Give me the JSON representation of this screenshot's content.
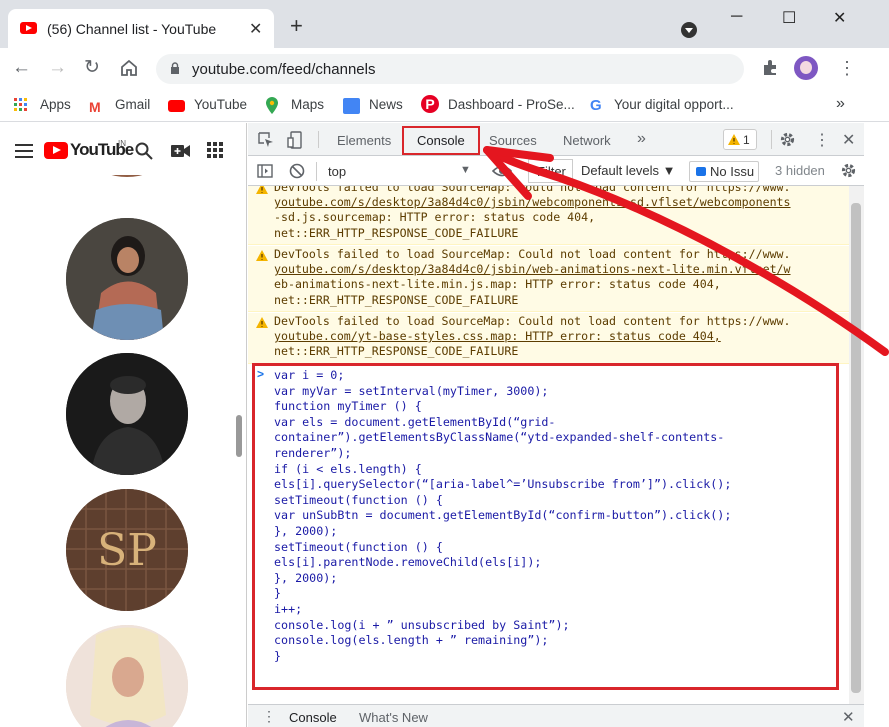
{
  "browser": {
    "tab_title": "(56) Channel list - YouTube",
    "tab_close": "✕",
    "new_tab": "+",
    "window_minimize": "─",
    "window_maximize": "☐",
    "window_close": "✕",
    "url": "youtube.com/feed/channels",
    "bookmarks": [
      "Apps",
      "Gmail",
      "YouTube",
      "Maps",
      "News",
      "Dashboard - ProSe...",
      "Your digital opport..."
    ],
    "bookmarks_more": "»"
  },
  "youtube": {
    "logo_text": "YouTube",
    "region": "IN",
    "avatar_icons": [
      "avatar-partial-icon",
      "avatar-woman-icon",
      "avatar-man-icon",
      "avatar-monogram-icon",
      "avatar-woman-blonde-icon"
    ]
  },
  "devtools": {
    "tabs": [
      "Elements",
      "Console",
      "Sources",
      "Network"
    ],
    "more_tabs": "»",
    "warning_count": "1",
    "context": "top",
    "filter_placeholder": "Filter",
    "levels": "Default levels ▼",
    "issues": "No Issu",
    "hidden": "3 hidden",
    "messages": [
      {
        "lines": [
          "DevTools failed to load SourceMap: Could not load content for https://www.",
          "youtube.com/s/desktop/3a84d4c0/jsbin/webcomponents-sd.vflset/webcomponents",
          "-sd.js.sourcemap: HTTP error: status code 404,",
          "net::ERR_HTTP_RESPONSE_CODE_FAILURE"
        ]
      },
      {
        "lines": [
          "DevTools failed to load SourceMap: Could not load content for https://www.",
          "youtube.com/s/desktop/3a84d4c0/jsbin/web-animations-next-lite.min.vflset/w",
          "eb-animations-next-lite.min.js.map: HTTP error: status code 404,",
          "net::ERR_HTTP_RESPONSE_CODE_FAILURE"
        ]
      },
      {
        "lines": [
          "DevTools failed to load SourceMap: Could not load content for https://www.",
          "youtube.com/yt-base-styles.css.map: HTTP error: status code 404,",
          "net::ERR_HTTP_RESPONSE_CODE_FAILURE"
        ]
      }
    ],
    "prompt": ">",
    "code_lines": [
      "var i = 0;",
      "var myVar = setInterval(myTimer, 3000);",
      "function myTimer () {",
      "var els = document.getElementById(“grid-",
      "container”).getElementsByClassName(“ytd-expanded-shelf-contents-",
      "renderer”);",
      "if (i < els.length) {",
      "els[i].querySelector(“[aria-label^=’Unsubscribe from’]”).click();",
      "setTimeout(function () {",
      "var unSubBtn = document.getElementById(“confirm-button”).click();",
      "}, 2000);",
      "setTimeout(function () {",
      "els[i].parentNode.removeChild(els[i]);",
      "}, 2000);",
      "}",
      "i++;",
      "console.log(i + ” unsubscribed by Saint”);",
      "console.log(els.length + ” remaining”);",
      "}"
    ],
    "drawer_tabs": [
      "Console",
      "What's New"
    ],
    "drawer_close": "✕"
  },
  "annotation": {
    "highlight_color": "#d9262b"
  }
}
